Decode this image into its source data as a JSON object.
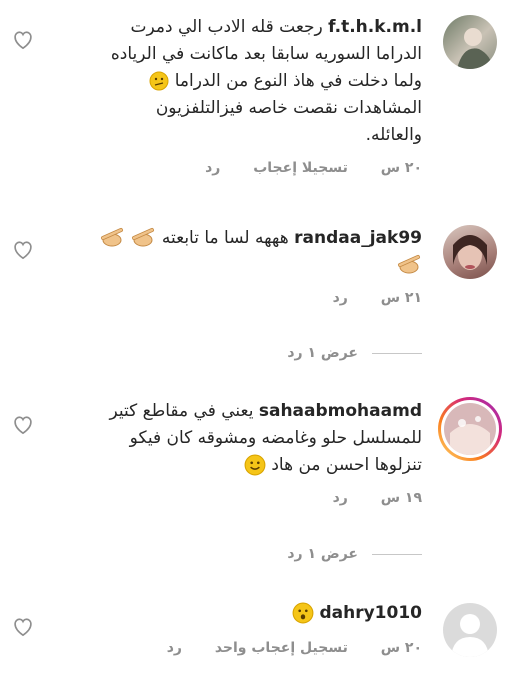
{
  "comments": [
    {
      "username": "f.t.h.k.m.l",
      "text_lines": [
        "رجعت قله الادب الي دمرت",
        "الدراما السوريه سابقا  بعد ماكانت في الرياده",
        "ولما دخلت في هاذ النوع من الدراما",
        "المشاهدات نقصت خاصه فيزالتلفزيون",
        "والعائله."
      ],
      "time": "٢٠ س",
      "likes_label": "تسجيلا إعجاب",
      "reply_label": "رد"
    },
    {
      "username": "randaa_jak99",
      "text_lines": [
        "هههه لسا ما تابعته"
      ],
      "time": "٢١ س",
      "reply_label": "رد",
      "view_replies": "عرض ١ رد"
    },
    {
      "username": "sahaabmohaamd",
      "text_lines": [
        "يعني في مقاطع كتير",
        "للمسلسل حلو وغامضه ومشوقه كان فيكو",
        "تنزلوها احسن من هاد"
      ],
      "time": "١٩ س",
      "reply_label": "رد",
      "view_replies": "عرض ١ رد"
    },
    {
      "username": "dahry1010",
      "text_lines": [
        ""
      ],
      "time": "٢٠ س",
      "likes_label": "تسجيل إعجاب واحد",
      "reply_label": "رد"
    }
  ],
  "icons": {
    "like": "heart-outline-icon",
    "emoji_confused": "confused-face-emoji",
    "emoji_peace": "peace-hand-emoji",
    "emoji_smile": "smiling-face-emoji",
    "emoji_surprised": "hushed-face-emoji"
  },
  "colors": {
    "text": "#262626",
    "meta": "#8e8e8e",
    "emoji": "#f5c518"
  }
}
